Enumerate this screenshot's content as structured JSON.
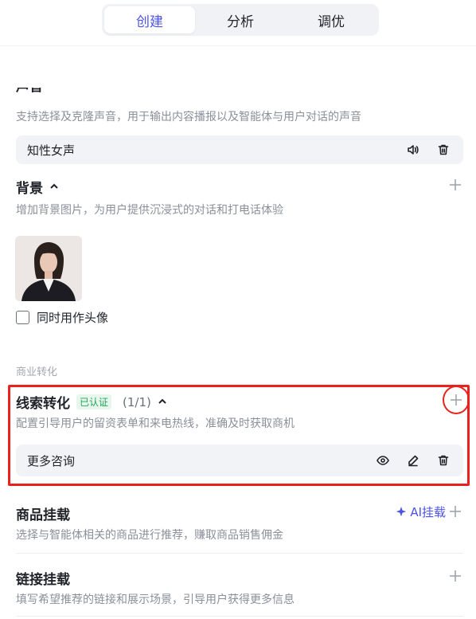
{
  "tabs": [
    {
      "label": "创建",
      "active": true
    },
    {
      "label": "分析",
      "active": false
    },
    {
      "label": "调优",
      "active": false
    }
  ],
  "voice": {
    "title_fragment": "声音",
    "description": "支持选择及克隆声音，用于输出内容播报以及智能体与用户对话的声音",
    "selected": "知性女声"
  },
  "background": {
    "title": "背景",
    "description": "增加背景图片，为用户提供沉浸式的对话和打电话体验",
    "use_as_avatar_label": "同时用作头像"
  },
  "commerce": {
    "group_label": "商业转化",
    "lead": {
      "title": "线索转化",
      "badge": "已认证",
      "count": "(1/1)",
      "description": "配置引导用户的留资表单和来电热线，准确及时获取商机",
      "item": "更多咨询"
    },
    "product": {
      "title": "商品挂载",
      "ai_label": "AI挂载",
      "description": "选择与智能体相关的商品进行推荐，赚取商品销售佣金"
    },
    "link": {
      "title": "链接挂载",
      "description": "填写希望推荐的链接和展示场景，引导用户获得更多信息"
    }
  },
  "colors": {
    "accent": "#4d53e8",
    "verified": "#23a455",
    "highlight": "#e8231d"
  }
}
